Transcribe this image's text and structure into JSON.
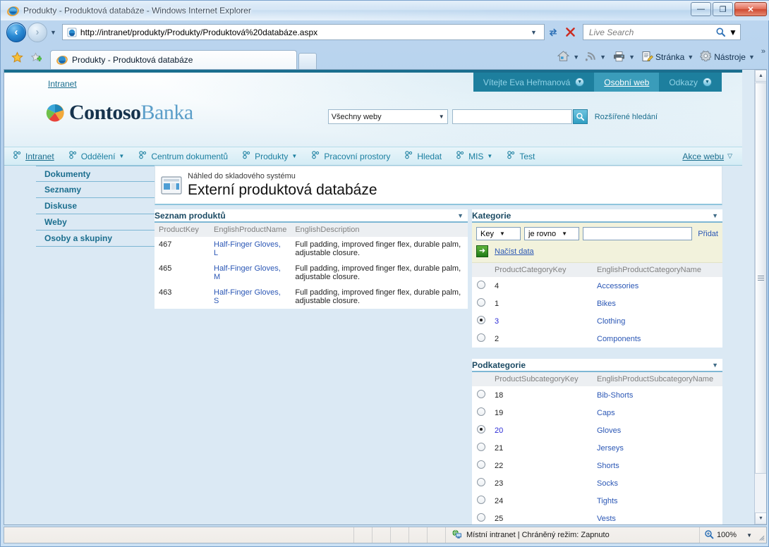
{
  "browser": {
    "window_title": "Produkty - Produktová databáze - Windows Internet Explorer",
    "url": "http://intranet/produkty/Produkty/Produktová%20databáze.aspx",
    "search_placeholder": "Live Search",
    "tab_label": "Produkty - Produktová databáze",
    "window_buttons": {
      "minimize": "—",
      "maximize": "❐",
      "close": "✕"
    },
    "commands": [
      {
        "name": "home",
        "label": ""
      },
      {
        "name": "feeds",
        "label": ""
      },
      {
        "name": "print",
        "label": ""
      },
      {
        "name": "page",
        "label": "Stránka"
      },
      {
        "name": "tools",
        "label": "Nástroje"
      }
    ],
    "overflow_label": "»"
  },
  "status": {
    "zone": "Místní intranet | Chráněný režim: Zapnuto",
    "zoom": "100%"
  },
  "sharepoint": {
    "breadcrumb": "Intranet",
    "top_tabs": [
      {
        "label": "Vítejte Eva Heřmanová",
        "active": false,
        "has_menu": true
      },
      {
        "label": "Osobní web",
        "active": true,
        "has_menu": false
      },
      {
        "label": "Odkazy",
        "active": false,
        "has_menu": true
      }
    ],
    "logo": {
      "bold": "Contoso",
      "light": "Banka"
    },
    "search": {
      "scope": "Všechny weby",
      "query": "",
      "advanced_label": "Rozšířené hledání"
    },
    "nav": [
      {
        "label": "Intranet",
        "current": true,
        "has_menu": false
      },
      {
        "label": "Oddělení",
        "current": false,
        "has_menu": true
      },
      {
        "label": "Centrum dokumentů",
        "current": false,
        "has_menu": false
      },
      {
        "label": "Produkty",
        "current": false,
        "has_menu": true
      },
      {
        "label": "Pracovní prostory",
        "current": false,
        "has_menu": false
      },
      {
        "label": "Hledat",
        "current": false,
        "has_menu": false
      },
      {
        "label": "MIS",
        "current": false,
        "has_menu": true
      },
      {
        "label": "Test",
        "current": false,
        "has_menu": false
      }
    ],
    "site_actions": "Akce webu",
    "quick_launch": [
      {
        "label": "Dokumenty"
      },
      {
        "label": "Seznamy"
      },
      {
        "label": "Diskuse"
      },
      {
        "label": "Weby"
      },
      {
        "label": "Osoby a skupiny"
      }
    ],
    "page_header": {
      "subtitle": "Náhled do skladového systému",
      "title": "Externí produktová databáze"
    }
  },
  "products_webpart": {
    "title": "Seznam produktů",
    "columns": [
      "ProductKey",
      "EnglishProductName",
      "EnglishDescription"
    ],
    "rows": [
      {
        "key": "467",
        "name": "Half-Finger Gloves, L",
        "description": "Full padding, improved finger flex, durable palm, adjustable closure."
      },
      {
        "key": "465",
        "name": "Half-Finger Gloves, M",
        "description": "Full padding, improved finger flex, durable palm, adjustable closure."
      },
      {
        "key": "463",
        "name": "Half-Finger Gloves, S",
        "description": "Full padding, improved finger flex, durable palm, adjustable closure."
      }
    ]
  },
  "categories_webpart": {
    "title": "Kategorie",
    "filter": {
      "field": "Key",
      "operator": "je rovno",
      "value": "",
      "add_label": "Přidat",
      "load_label": "Načíst data"
    },
    "columns": [
      "ProductCategoryKey",
      "EnglishProductCategoryName"
    ],
    "rows": [
      {
        "key": "4",
        "name": "Accessories",
        "selected": false
      },
      {
        "key": "1",
        "name": "Bikes",
        "selected": false
      },
      {
        "key": "3",
        "name": "Clothing",
        "selected": true
      },
      {
        "key": "2",
        "name": "Components",
        "selected": false
      }
    ]
  },
  "subcategories_webpart": {
    "title": "Podkategorie",
    "columns": [
      "ProductSubcategoryKey",
      "EnglishProductSubcategoryName"
    ],
    "rows": [
      {
        "key": "18",
        "name": "Bib-Shorts",
        "selected": false
      },
      {
        "key": "19",
        "name": "Caps",
        "selected": false
      },
      {
        "key": "20",
        "name": "Gloves",
        "selected": true
      },
      {
        "key": "21",
        "name": "Jerseys",
        "selected": false
      },
      {
        "key": "22",
        "name": "Shorts",
        "selected": false
      },
      {
        "key": "23",
        "name": "Socks",
        "selected": false
      },
      {
        "key": "24",
        "name": "Tights",
        "selected": false
      },
      {
        "key": "25",
        "name": "Vests",
        "selected": false
      }
    ]
  },
  "colors": {
    "accent": "#1b6e8e",
    "tab_active": "#3a9cba",
    "tab_inactive": "#1d7f9e",
    "link": "#2b57b5",
    "filter_bg": "#f2f2dc",
    "selected_key": "#2b2bd6"
  }
}
